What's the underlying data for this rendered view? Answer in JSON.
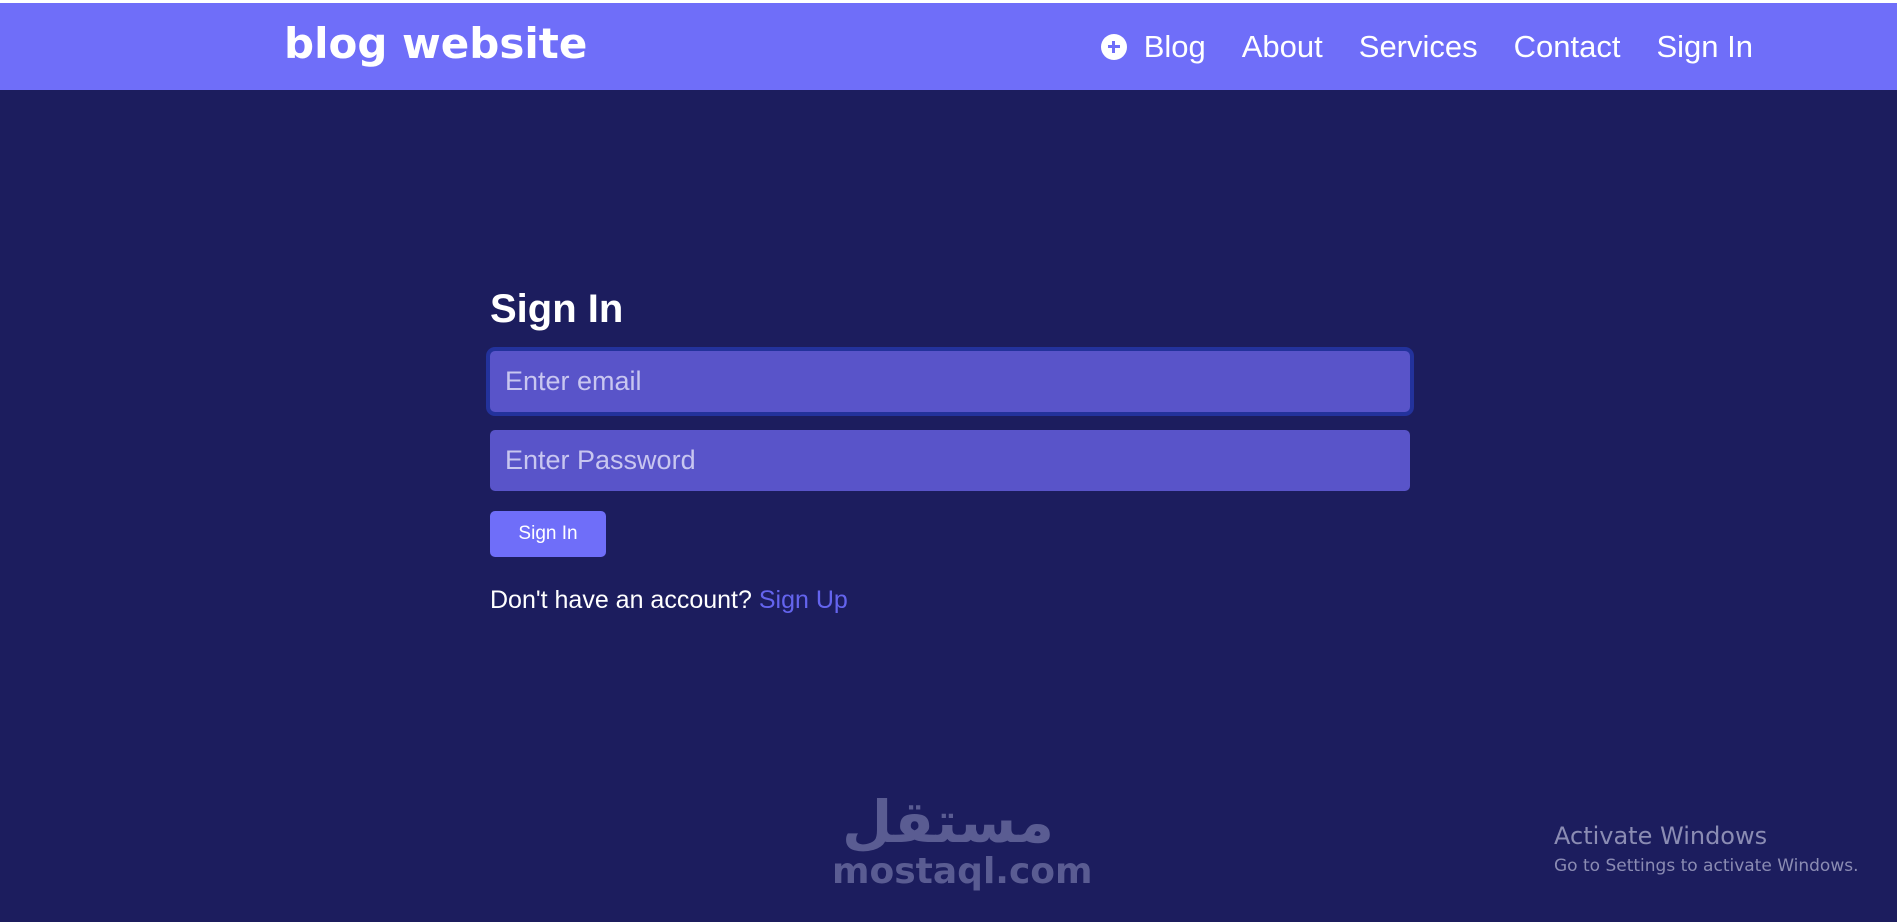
{
  "nav": {
    "brand": "blog website",
    "items": [
      {
        "label": "Blog",
        "icon": "plus-circle-icon"
      },
      {
        "label": "About"
      },
      {
        "label": "Services"
      },
      {
        "label": "Contact"
      },
      {
        "label": "Sign In"
      }
    ]
  },
  "form": {
    "title": "Sign In",
    "email_placeholder": "Enter email",
    "password_placeholder": "Enter Password",
    "submit_label": "Sign In",
    "account_prompt": "Don't have an account?",
    "signup_label": "Sign Up"
  },
  "watermark": {
    "arabic": "مستقل",
    "latin": "mostaql.com"
  },
  "os_notice": {
    "title": "Activate Windows",
    "subtitle": "Go to Settings to activate Windows."
  },
  "colors": {
    "navbar": "#6f6ef9",
    "background": "#1c1d5e",
    "input": "#5954c9",
    "link": "#6464ee"
  }
}
